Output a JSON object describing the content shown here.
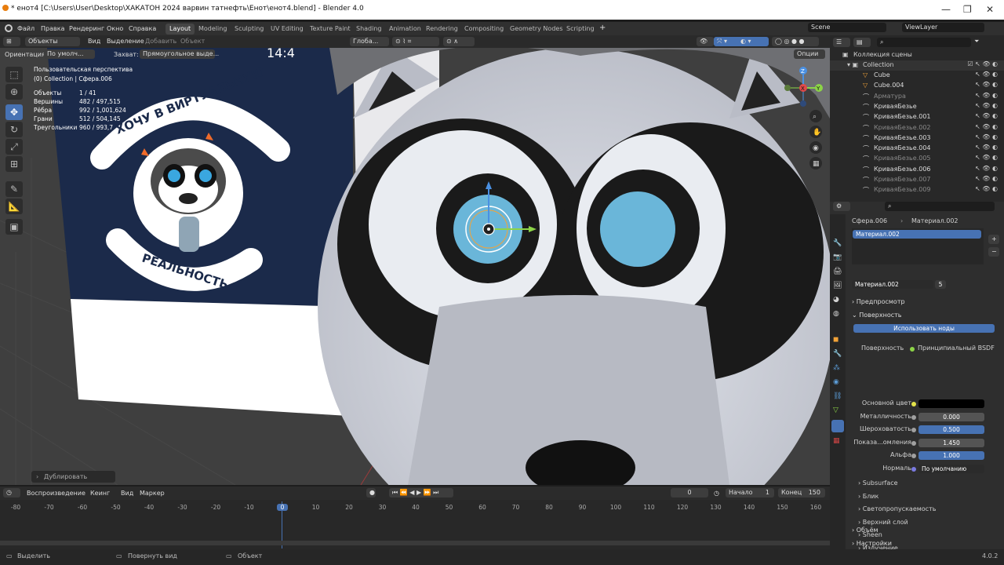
{
  "title_bar": {
    "title": "* енот4 [C:\\Users\\User\\Desktop\\ХАКАТОН 2024 варвин татнефть\\Енот\\енот4.blend] - Blender 4.0",
    "controls": [
      "minimize-icon",
      "maximize-icon",
      "close-icon"
    ]
  },
  "menu": {
    "items": [
      "Файл",
      "Правка",
      "Рендеринг",
      "Окно",
      "Справка"
    ],
    "workspaces": [
      "Layout",
      "Modeling",
      "Sculpting",
      "UV Editing",
      "Texture Paint",
      "Shading",
      "Animation",
      "Rendering",
      "Compositing",
      "Geometry Nodes",
      "Scripting"
    ],
    "active_workspace": "Layout",
    "scene": "Scene",
    "view_layer": "ViewLayer"
  },
  "viewport_header": {
    "mode": "Объекты",
    "menus": [
      "Вид",
      "Выделение",
      "Добавить",
      "Объект"
    ],
    "transform": "Глоба...",
    "orientation_label": "Ориентация:",
    "orientation_value": "По умолч...",
    "snap_label": "Захват:",
    "snap_value": "Прямоугольное выде...",
    "options": "Опции"
  },
  "viewport": {
    "view_name": "Пользовательская перспектива",
    "context": "(0) Collection | Сфера.006",
    "stats": [
      {
        "label": "Объекты",
        "value": "1 / 41"
      },
      {
        "label": "Вершины",
        "value": "482 / 497,515"
      },
      {
        "label": "Рёбра",
        "value": "992 / 1,001,624"
      },
      {
        "label": "Грани",
        "value": "512 / 504,145"
      },
      {
        "label": "Треугольники",
        "value": "960 / 993,7"
      }
    ],
    "sticker_top_text": "ХОЧУ В ВИРТУАЛЬНУЮ",
    "sticker_bottom_text": "РЕАЛЬНОСТЬ",
    "clock_text": "14:4",
    "last_operator": "Дублировать",
    "axes": [
      "X",
      "Y",
      "Z"
    ]
  },
  "outliner": {
    "header": "Коллекция сцены",
    "collection": "Collection",
    "items": [
      {
        "name": "Cube",
        "dim": false
      },
      {
        "name": "Cube.004",
        "dim": false
      },
      {
        "name": "Арматура",
        "dim": true
      },
      {
        "name": "КриваяБезье",
        "dim": false
      },
      {
        "name": "КриваяБезье.001",
        "dim": false
      },
      {
        "name": "КриваяБезье.002",
        "dim": true
      },
      {
        "name": "КриваяБезье.003",
        "dim": false
      },
      {
        "name": "КриваяБезье.004",
        "dim": false
      },
      {
        "name": "КриваяБезье.005",
        "dim": true
      },
      {
        "name": "КриваяБезье.006",
        "dim": false
      },
      {
        "name": "КриваяБезье.007",
        "dim": true
      },
      {
        "name": "КриваяБезье.009",
        "dim": true
      }
    ]
  },
  "properties": {
    "breadcrumb_object": "Сфера.006",
    "breadcrumb_material": "Материал.002",
    "slot": "Материал.002",
    "material_name": "Материал.002",
    "users": "5",
    "section_preview": "Предпросмотр",
    "section_surface": "Поверхность",
    "use_nodes": "Использовать ноды",
    "surface_label": "Поверхность",
    "surface_value": "Принципиальный BSDF",
    "fields": [
      {
        "label": "Основной цвет",
        "value": "",
        "kind": "color"
      },
      {
        "label": "Металличность",
        "value": "0.000",
        "kind": "num"
      },
      {
        "label": "Шероховатость",
        "value": "0.500",
        "kind": "blue"
      },
      {
        "label": "Показа...омления",
        "value": "1.450",
        "kind": "num"
      },
      {
        "label": "Альфа",
        "value": "1.000",
        "kind": "blue"
      },
      {
        "label": "Нормаль",
        "value": "По умолчанию",
        "kind": "text"
      }
    ],
    "subsections": [
      "Subsurface",
      "Блик",
      "Светопропускаемость",
      "Верхний слой",
      "Sheen",
      "Излучение"
    ],
    "section_volume": "Объём",
    "section_settings": "Настройки",
    "base_color": "#000000"
  },
  "timeline": {
    "menus": [
      "Воспроизведение",
      "Кеинг",
      "Вид",
      "Маркер"
    ],
    "current_frame": "0",
    "start_label": "Начало",
    "start": "1",
    "end_label": "Конец",
    "end": "150",
    "ticks": [
      "-80",
      "-70",
      "-60",
      "-50",
      "-40",
      "-30",
      "-20",
      "-10",
      "0",
      "10",
      "20",
      "30",
      "40",
      "50",
      "60",
      "70",
      "80",
      "90",
      "100",
      "110",
      "120",
      "130",
      "140",
      "150",
      "160"
    ]
  },
  "status": {
    "select": "Выделить",
    "rotate": "Повернуть вид",
    "object": "Объект",
    "version": "4.0.2"
  },
  "colors": {
    "accent": "#4772b3",
    "eye_blue": "#6ab6d9",
    "sticker_navy": "#1b2a4a"
  }
}
